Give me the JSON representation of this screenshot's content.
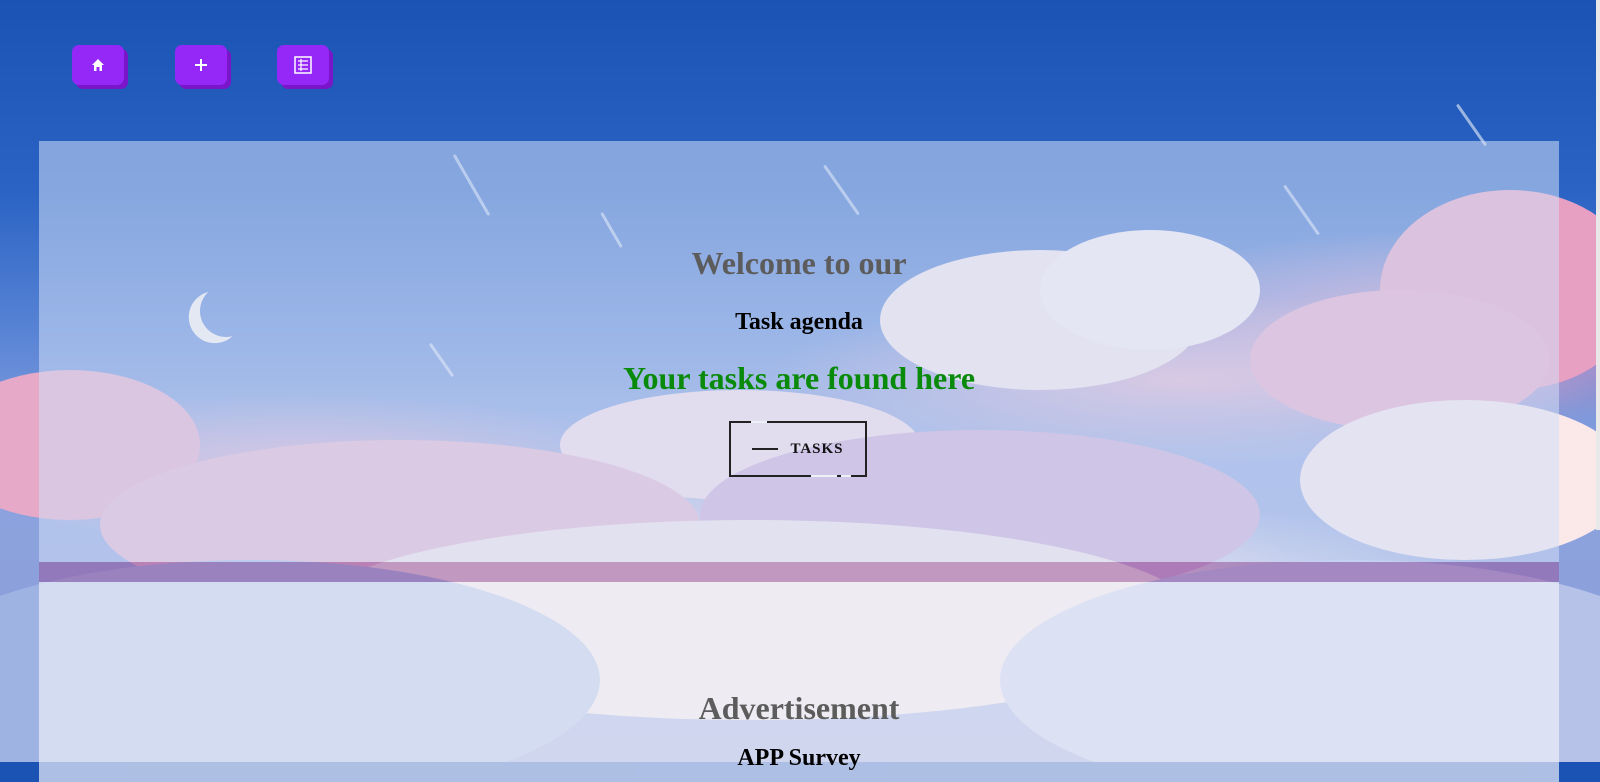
{
  "nav": {
    "home_icon": "home-icon",
    "add_icon": "plus-icon",
    "list_icon": "list-icon"
  },
  "hero": {
    "welcome": "Welcome to our",
    "agenda": "Task agenda",
    "found": "Your tasks are found here",
    "tasks_button": "TASKS"
  },
  "ad": {
    "title": "Advertisement",
    "subtitle": "APP Survey"
  },
  "colors": {
    "background": "#1b53b5",
    "nav_button": "#9628f7",
    "found_text": "#0a8a0a",
    "heading_gray": "#5c5c5c"
  }
}
